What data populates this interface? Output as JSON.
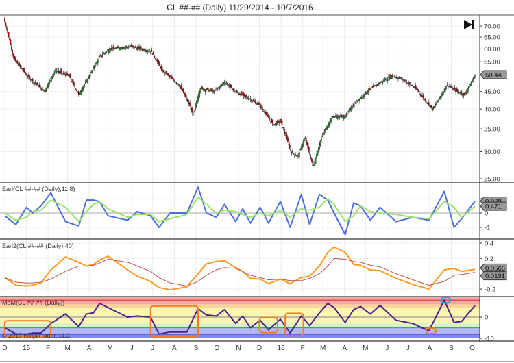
{
  "title": "CL ##-## (Daily)  11/29/2014 - 10/7/2016",
  "copyright": "© 2017 NinjaTrader, LLC",
  "chart_data": [
    {
      "type": "candlestick",
      "name": "price",
      "yscale": "log",
      "ylim": [
        25,
        75
      ],
      "ticks": [
        70,
        65,
        60,
        55,
        45,
        40,
        35,
        30,
        25
      ],
      "last_value": "50.44",
      "last": 50.44,
      "colors": {
        "up": "#2e8b2e",
        "down": "#cc0000"
      },
      "points": [
        [
          "2014-12-01",
          72
        ],
        [
          "2014-12-14",
          56
        ],
        [
          "2015-01-02",
          50
        ],
        [
          "2015-01-27",
          45
        ],
        [
          "2015-02-11",
          52
        ],
        [
          "2015-03-03",
          50
        ],
        [
          "2015-03-17",
          44
        ],
        [
          "2015-04-01",
          50
        ],
        [
          "2015-04-16",
          57
        ],
        [
          "2015-05-01",
          60
        ],
        [
          "2015-05-30",
          61
        ],
        [
          "2015-06-29",
          59
        ],
        [
          "2015-07-14",
          52
        ],
        [
          "2015-08-08",
          47
        ],
        [
          "2015-08-23",
          41
        ],
        [
          "2015-08-28",
          38
        ],
        [
          "2015-09-07",
          46
        ],
        [
          "2015-09-27",
          45
        ],
        [
          "2015-10-12",
          48
        ],
        [
          "2015-10-27",
          45
        ],
        [
          "2015-11-16",
          43
        ],
        [
          "2015-12-01",
          41
        ],
        [
          "2015-12-21",
          36
        ],
        [
          "2015-12-31",
          37
        ],
        [
          "2016-01-15",
          30
        ],
        [
          "2016-01-25",
          29
        ],
        [
          "2016-02-04",
          33
        ],
        [
          "2016-02-16",
          27
        ],
        [
          "2016-02-28",
          33
        ],
        [
          "2016-03-14",
          38
        ],
        [
          "2016-04-03",
          38
        ],
        [
          "2016-04-08",
          40
        ],
        [
          "2016-05-03",
          45
        ],
        [
          "2016-05-23",
          48
        ],
        [
          "2016-06-07",
          50
        ],
        [
          "2016-06-22",
          49
        ],
        [
          "2016-07-12",
          46
        ],
        [
          "2016-07-27",
          42
        ],
        [
          "2016-08-06",
          40
        ],
        [
          "2016-08-26",
          47
        ],
        [
          "2016-09-10",
          45
        ],
        [
          "2016-09-20",
          44
        ],
        [
          "2016-10-06",
          50.44
        ]
      ]
    },
    {
      "type": "line",
      "label": "Earl(CL ##-## (Daily),11,8)",
      "ticks": [
        1,
        0,
        -1
      ],
      "tick_labels": [
        "",
        "0",
        "-1"
      ],
      "ylim": [
        -1.7,
        2.0
      ],
      "last_values": [
        "0.828",
        "0.471"
      ],
      "x": [
        "2014-12-01",
        "2014-12-17",
        "2015-01-01",
        "2015-01-10",
        "2015-01-22",
        "2015-02-05",
        "2015-02-26",
        "2015-03-17",
        "2015-03-28",
        "2015-04-07",
        "2015-04-16",
        "2015-04-28",
        "2015-05-26",
        "2015-06-09",
        "2015-06-28",
        "2015-07-10",
        "2015-07-26",
        "2015-08-19",
        "2015-09-04",
        "2015-09-16",
        "2015-09-30",
        "2015-10-12",
        "2015-10-28",
        "2015-11-07",
        "2015-11-18",
        "2015-12-02",
        "2015-12-14",
        "2015-12-31",
        "2016-01-14",
        "2016-01-30",
        "2016-02-11",
        "2016-02-25",
        "2016-03-08",
        "2016-03-17",
        "2016-04-02",
        "2016-04-14",
        "2016-04-24",
        "2016-05-08",
        "2016-05-22",
        "2016-06-14",
        "2016-07-08",
        "2016-07-31",
        "2016-08-22",
        "2016-09-05",
        "2016-09-16",
        "2016-10-05"
      ],
      "series": [
        {
          "color": "#4a6fdc",
          "values": [
            -0.2,
            -0.8,
            0.4,
            0,
            0.5,
            1.4,
            -0.6,
            -0.9,
            0.9,
            0.9,
            0.8,
            -0.2,
            -0.5,
            0.1,
            -0.2,
            -1.0,
            0,
            0,
            1.8,
            0,
            -0.3,
            0.6,
            -0.6,
            0.3,
            -0.7,
            0.4,
            -0.7,
            0.8,
            -1.0,
            1.3,
            -0.8,
            1.3,
            0.9,
            0,
            -1.5,
            0.7,
            0.5,
            -0.5,
            0.4,
            -0.6,
            -0.3,
            -0.5,
            1.5,
            -1.0,
            -0.4,
            0.828
          ]
        },
        {
          "color": "#9be36b",
          "values": [
            0,
            -0.5,
            -0.3,
            0.1,
            0.2,
            0.9,
            0.4,
            -0.6,
            0.1,
            0.6,
            0.8,
            0.3,
            -0.3,
            -0.1,
            -0.1,
            -0.6,
            -0.4,
            -0.1,
            1.1,
            0.6,
            0,
            0.2,
            0.1,
            -0.1,
            -0.3,
            0,
            -0.2,
            0.2,
            -0.3,
            0.3,
            0.2,
            0.4,
            1.0,
            0.6,
            -0.6,
            -0.2,
            0.5,
            0.1,
            0,
            -0.1,
            -0.3,
            -0.4,
            0.8,
            0.4,
            -0.3,
            0.471
          ]
        }
      ]
    },
    {
      "type": "line",
      "label": "Earl2(CL ##-## (Daily),40)",
      "ticks": [
        0.4,
        0.2,
        -0.2
      ],
      "ylim": [
        -0.27,
        0.43
      ],
      "last_values": [
        "0.0566",
        "0.0191"
      ],
      "x": "same as Earl",
      "series": [
        {
          "color": "#ff9a1f",
          "values": [
            -0.05,
            -0.15,
            -0.16,
            -0.15,
            -0.12,
            0.05,
            0.22,
            0.15,
            0.1,
            0.12,
            0.18,
            0.23,
            0.05,
            -0.03,
            -0.1,
            -0.18,
            -0.21,
            -0.17,
            0.0,
            0.13,
            0.16,
            0.17,
            0.08,
            0.03,
            -0.06,
            -0.07,
            -0.13,
            -0.07,
            -0.13,
            -0.05,
            -0.03,
            0.1,
            0.28,
            0.35,
            0.28,
            0.12,
            0.11,
            0.05,
            0.04,
            -0.06,
            -0.14,
            -0.2,
            0.05,
            0.07,
            0.03,
            0.0566
          ]
        },
        {
          "color": "#c0504d",
          "values": [
            -0.05,
            -0.11,
            -0.12,
            -0.12,
            -0.11,
            -0.07,
            0.03,
            0.1,
            0.1,
            0.11,
            0.14,
            0.19,
            0.15,
            0.1,
            0.03,
            -0.05,
            -0.12,
            -0.16,
            -0.1,
            -0.02,
            0.05,
            0.08,
            0.07,
            0.03,
            -0.02,
            -0.05,
            -0.08,
            -0.07,
            -0.09,
            -0.09,
            -0.06,
            0.0,
            0.1,
            0.2,
            0.19,
            0.16,
            0.15,
            0.11,
            0.09,
            0.0,
            -0.08,
            -0.15,
            -0.1,
            -0.02,
            -0.01,
            0.0191
          ]
        }
      ]
    },
    {
      "type": "line",
      "label": "MoM(CL ##-## (Daily))",
      "ticks": [
        0,
        -10
      ],
      "ylim": [
        -11,
        10
      ],
      "x": "same as Earl",
      "bands": [
        {
          "from": 6,
          "to": 9.5,
          "color": "#f7a8a8"
        },
        {
          "from": 4.5,
          "to": 6,
          "color": "#fcd49a"
        },
        {
          "from": -3,
          "to": 4.5,
          "color": "#fbf6b0"
        },
        {
          "from": -5,
          "to": -3,
          "color": "#d9f0c8"
        },
        {
          "from": -8,
          "to": -5,
          "color": "#b3b8f5"
        },
        {
          "from": -10,
          "to": -8,
          "color": "#8088ee"
        }
      ],
      "levels": [
        {
          "value": 8,
          "color": "#e03030"
        },
        {
          "value": -5,
          "color": "#3cb043"
        },
        {
          "value": -8,
          "color": "#2a2ad0"
        },
        {
          "value": 0,
          "color": "#999999"
        }
      ],
      "series": [
        {
          "color": "#4b1f8c",
          "values": [
            -5,
            -8,
            -8,
            -7.5,
            -7.5,
            -3,
            1.5,
            -4.5,
            1.5,
            2,
            6.5,
            4.5,
            0,
            0.5,
            0,
            -8,
            -7,
            -7,
            4,
            1,
            0.5,
            3.5,
            -3,
            0.5,
            -5,
            -1.5,
            -6,
            -1,
            -7.5,
            0.5,
            -4,
            2,
            6.5,
            4.5,
            -2.5,
            3.5,
            5,
            1.5,
            5.5,
            -1.5,
            -3,
            -6.5,
            8,
            -2.5,
            -2,
            5.5
          ]
        }
      ],
      "highlights": [
        {
          "from": "2014-12-01",
          "to": "2015-02-05",
          "color": "#f07b22"
        },
        {
          "from": "2015-06-28",
          "to": "2015-09-04",
          "color": "#f07b22"
        },
        {
          "from": "2015-12-01",
          "to": "2015-12-27",
          "color": "#f07b22"
        },
        {
          "from": "2016-01-07",
          "to": "2016-02-02",
          "color": "#f07b22"
        },
        {
          "from": "2016-07-27",
          "to": "2016-08-10",
          "color": "#f07b22"
        },
        {
          "from": "2016-08-17",
          "to": "2016-08-31",
          "color": "#27a4dd"
        }
      ]
    }
  ],
  "xaxis": {
    "labels": [
      [
        "2014-12-01",
        "D"
      ],
      [
        "2015-01-01",
        "15"
      ],
      [
        "2015-02-01",
        "F"
      ],
      [
        "2015-03-01",
        "M"
      ],
      [
        "2015-04-01",
        "A"
      ],
      [
        "2015-05-01",
        "M"
      ],
      [
        "2015-06-01",
        "J"
      ],
      [
        "2015-07-01",
        "J"
      ],
      [
        "2015-08-01",
        "A"
      ],
      [
        "2015-09-01",
        "S"
      ],
      [
        "2015-10-01",
        "O"
      ],
      [
        "2015-11-01",
        "N"
      ],
      [
        "2015-12-01",
        "D"
      ],
      [
        "2016-01-01",
        "16"
      ],
      [
        "2016-02-01",
        "F"
      ],
      [
        "2016-03-01",
        "M"
      ],
      [
        "2016-04-01",
        "A"
      ],
      [
        "2016-05-01",
        "M"
      ],
      [
        "2016-06-01",
        "J"
      ],
      [
        "2016-07-01",
        "J"
      ],
      [
        "2016-08-01",
        "A"
      ],
      [
        "2016-09-01",
        "S"
      ],
      [
        "2016-10-01",
        "O"
      ]
    ]
  }
}
